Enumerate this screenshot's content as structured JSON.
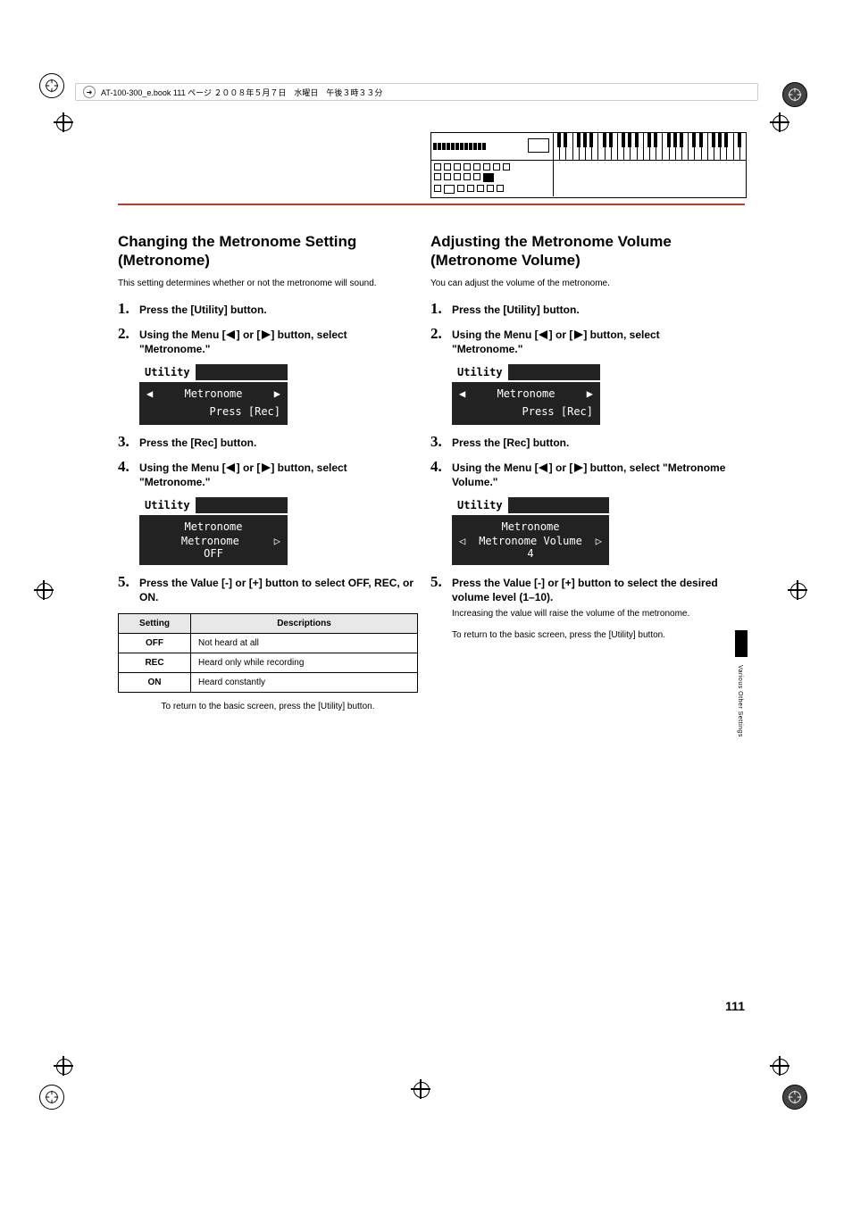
{
  "header_text": "AT-100-300_e.book  111 ページ  ２００８年５月７日　水曜日　午後３時３３分",
  "side_label": "Various Other Settings",
  "page_number": "111",
  "left": {
    "heading": "Changing the Metronome Setting (Metronome)",
    "intro": "This setting determines whether or not the metronome will sound.",
    "step1": "Press the [Utility] button.",
    "step2_pre": "Using the Menu [",
    "step2_mid": "] or [",
    "step2_post": "] button, select \"Metronome.\"",
    "lcd1_title": "Utility",
    "lcd1_line": "Metronome",
    "lcd1_hint": "Press [Rec]",
    "step3": "Press the [Rec] button.",
    "step4_pre": "Using the Menu [",
    "step4_mid": "] or [",
    "step4_post": "] button, select \"Metronome.\"",
    "lcd2_title": "Utility",
    "lcd2_l1": "Metronome",
    "lcd2_l2": "Metronome",
    "lcd2_l3": "OFF",
    "step5": "Press the Value [-] or [+] button to select OFF, REC, or ON.",
    "table": {
      "h1": "Setting",
      "h2": "Descriptions",
      "rows": [
        {
          "k": "OFF",
          "v": "Not heard at all"
        },
        {
          "k": "REC",
          "v": "Heard only while recording"
        },
        {
          "k": "ON",
          "v": "Heard constantly"
        }
      ]
    },
    "return_note": "To return to the basic screen, press the [Utility] button."
  },
  "right": {
    "heading": "Adjusting the Metronome Volume (Metronome Volume)",
    "intro": "You can adjust the volume of the metronome.",
    "step1": "Press the [Utility] button.",
    "step2_pre": "Using the Menu [",
    "step2_mid": "] or [",
    "step2_post": "] button, select \"Metronome.\"",
    "lcd1_title": "Utility",
    "lcd1_line": "Metronome",
    "lcd1_hint": "Press [Rec]",
    "step3": "Press the [Rec] button.",
    "step4_pre": "Using the Menu [",
    "step4_mid": "] or [",
    "step4_post": "] button, select \"Metronome Volume.\"",
    "lcd2_title": "Utility",
    "lcd2_l1": "Metronome",
    "lcd2_l2": "Metronome Volume",
    "lcd2_l3": "4",
    "step5": "Press the Value [-] or [+] button to select the desired volume level (1–10).",
    "step5_sub": "Increasing the value will raise the volume of the metronome.",
    "return_note": "To return to the basic screen, press the [Utility] button."
  }
}
